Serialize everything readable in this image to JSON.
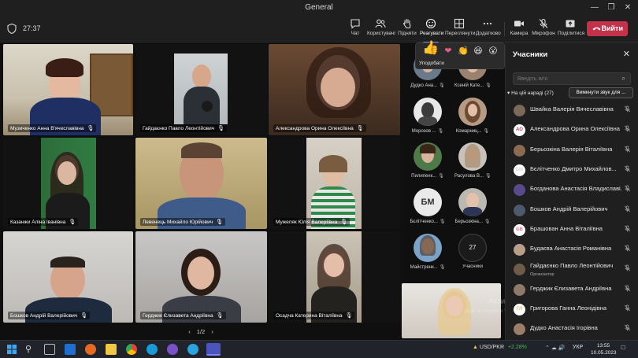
{
  "window": {
    "title": "General"
  },
  "meeting": {
    "timer": "27:37"
  },
  "toolbar": {
    "chat": "Чат",
    "people": "Користувачі",
    "raise": "Підняти",
    "react": "Реагувати",
    "view": "Переглянути",
    "more": "Додатково",
    "camera": "Камера",
    "mic": "Мікрофон",
    "share": "Поділитися",
    "leave": "Вийти"
  },
  "reactions": {
    "label": "Уподобати"
  },
  "tiles": [
    {
      "name": "Музиченко Анна В'ячеславівна"
    },
    {
      "name": "Гайдаєнко Павло Леонтійович"
    },
    {
      "name": "Александрова Орина Олексіївна"
    },
    {
      "name": "Казанжи Аліна Іванівна"
    },
    {
      "name": "Левенець Михайло Юрійович"
    },
    {
      "name": "Мужеляк Юлія Валеріївна"
    },
    {
      "name": "Бошков Андрій Валерійович"
    },
    {
      "name": "Герджик Єлизавета Андріївна"
    },
    {
      "name": "Осадча Катерина Віталіївна"
    }
  ],
  "thumbs": [
    {
      "name": "Дудко Ана...",
      "initials": ""
    },
    {
      "name": "Ксеній Кате...",
      "initials": ""
    },
    {
      "name": "Морозов ...",
      "initials": ""
    },
    {
      "name": "Комарниц...",
      "initials": ""
    },
    {
      "name": "Пилипенк...",
      "initials": ""
    },
    {
      "name": "Расулова В...",
      "initials": ""
    },
    {
      "name": "Бєлітченко...",
      "initials": "БМ"
    },
    {
      "name": "Берьозкіна...",
      "initials": ""
    },
    {
      "name": "Майстренк...",
      "initials": ""
    },
    {
      "name": "Учасники",
      "initials": "27"
    }
  ],
  "pager": {
    "text": "1/2"
  },
  "panel": {
    "title": "Учасники",
    "search_placeholder": "Введіть ім'я",
    "section": "На цій нараді (27)",
    "mute_all": "Вимкнути звук для ...",
    "participants": [
      {
        "name": "Швайка Валерія Вячеславівна",
        "initials": "",
        "role": ""
      },
      {
        "name": "Александрова Орина Олексіївна",
        "initials": "АО",
        "role": ""
      },
      {
        "name": "Берьозкіна Валерія Віталіївна",
        "initials": "",
        "role": ""
      },
      {
        "name": "Бєлітченко Дмитро Михайлов...",
        "initials": "БМ",
        "role": ""
      },
      {
        "name": "Богданова Анастасія Владиславі...",
        "initials": "",
        "role": ""
      },
      {
        "name": "Бошков Андрій Валерійович",
        "initials": "",
        "role": ""
      },
      {
        "name": "Брашован Анна Віталіївна",
        "initials": "БВ",
        "role": ""
      },
      {
        "name": "Будаєва Анастасія Романівна",
        "initials": "",
        "role": ""
      },
      {
        "name": "Гайдаєнко Павло Леонтійович",
        "initials": "",
        "role": "Організатор"
      },
      {
        "name": "Герджик Єлизавета Андріївна",
        "initials": "",
        "role": ""
      },
      {
        "name": "Григорова Ганна Леонідівна",
        "initials": "ГЛ",
        "role": ""
      },
      {
        "name": "Дудко Анастасія Ігорівна",
        "initials": "",
        "role": ""
      }
    ]
  },
  "watermark": {
    "line1": "Активація Windows",
    "line2": "Щоб активувати Windows, перейдіть до"
  },
  "taskbar": {
    "ticker": "USD/PKR",
    "change": "+2.28%",
    "lang": "УКР",
    "time": "13:55",
    "date": "10.05.2023"
  },
  "colors": {
    "accent": "#7f85f5",
    "leave": "#c4314b",
    "positive": "#3fb950"
  }
}
